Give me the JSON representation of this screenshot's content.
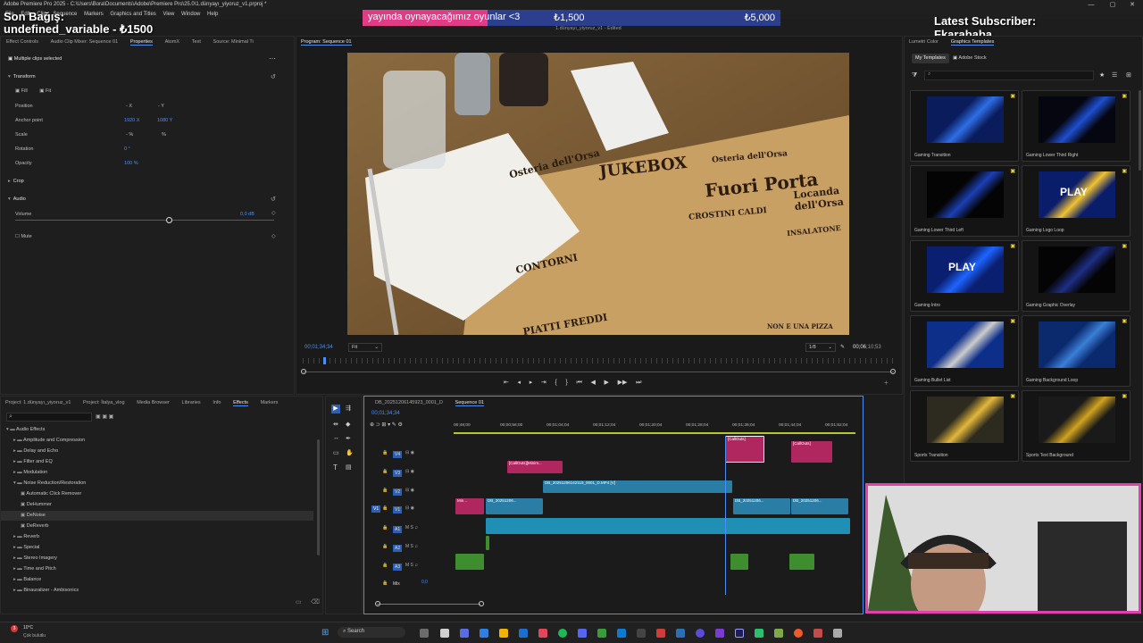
{
  "window": {
    "title": "Adobe Premiere Pro 2025 - C:\\Users\\Bora\\Documents\\Adobe\\Premiere Pro\\25.0\\1.dünyayı_yiyoruz_v1.prproj *",
    "controls": [
      "—",
      "▢",
      "✕"
    ]
  },
  "menu": [
    "File",
    "Edit",
    "Clip",
    "Sequence",
    "Markers",
    "Graphics and Titles",
    "View",
    "Window",
    "Help"
  ],
  "stream": {
    "banner_text": "yayında oynayacağımız oyunlar <3",
    "banner_value_1": "₺1,500",
    "banner_value_2": "₺5,000",
    "overlay_left_1": "Son Bağış:",
    "overlay_left_2": "undefined_variable - ₺1500",
    "overlay_right_1": "Latest Subscriber:",
    "overlay_right_2": "Fkarababa"
  },
  "effect_controls": {
    "tabs": [
      "Effect Controls",
      "Audio Clip Mixer: Sequence 01",
      "Properties",
      "AtomX",
      "Text",
      "Source: Minimal Ti"
    ],
    "active_tab": "Properties",
    "header": "Multiple clips selected",
    "transform_label": "Transform",
    "fill_label": "Fill",
    "fit_label": "Fit",
    "rows": [
      {
        "label": "Position",
        "value1": "- X",
        "value2": "- Y"
      },
      {
        "label": "Anchor point",
        "value1": "1920 X",
        "value2": "1080 Y"
      },
      {
        "label": "Scale",
        "value1": "- %",
        "value2": "%"
      },
      {
        "label": "Rotation",
        "value1": "0 °",
        "value2": ""
      },
      {
        "label": "Opacity",
        "value1": "100 %",
        "value2": ""
      }
    ],
    "crop_label": "Crop",
    "audio_label": "Audio",
    "volume_label": "Volume",
    "volume_value": "0,0 dB",
    "mute_label": "Mute"
  },
  "program": {
    "tab": "Program: Sequence 01",
    "subtitle": "1.dünyayı_yiyoruz_v1 - Edited",
    "timecode": "00;01;34;34",
    "fit": "Fit",
    "quality": "1/8",
    "duration_a": "00;06",
    "duration_b": ";10;53",
    "sign_1": "Osteria dell'Orsa",
    "sign_2": "JUKEBOX",
    "sign_3": "Osteria dell'Orsa",
    "sign_4": "Fuori Porta",
    "sign_5": "Locanda dell'Orsa",
    "sign_6": "CONTORNI",
    "sign_7": "PIATTI FREDDI",
    "sign_8": "CROSTINI CALDI",
    "sign_9": "INSALATONE",
    "sign_10": "NON E UNA PIZZA",
    "controls": [
      "⇤",
      "◂",
      "▸",
      "⇥",
      "{",
      "}",
      "⏮",
      "◀",
      "▶",
      "▶▶",
      "⏭"
    ]
  },
  "project": {
    "tabs": [
      "Project: 1.dünyayı_yiyoruz_v1",
      "Project: İtalya_vlog",
      "Media Browser",
      "Libraries",
      "Info",
      "Effects",
      "Markers"
    ],
    "active_tab": "Effects",
    "search_placeholder": "",
    "items": [
      {
        "label": "Audio Effects",
        "indent": 1,
        "open": true
      },
      {
        "label": "Amplitude and Compression",
        "indent": 2,
        "open": false
      },
      {
        "label": "Delay and Echo",
        "indent": 2,
        "open": false
      },
      {
        "label": "Filter and EQ",
        "indent": 2,
        "open": false
      },
      {
        "label": "Modulation",
        "indent": 2,
        "open": false
      },
      {
        "label": "Noise Reduction/Restoration",
        "indent": 2,
        "open": true
      },
      {
        "label": "Automatic Click Remover",
        "indent": 3,
        "open": false
      },
      {
        "label": "DeHummer",
        "indent": 3,
        "open": false
      },
      {
        "label": "DeNoise",
        "indent": 3,
        "open": false,
        "selected": true
      },
      {
        "label": "DeReverb",
        "indent": 3,
        "open": false
      },
      {
        "label": "Reverb",
        "indent": 2,
        "open": false
      },
      {
        "label": "Special",
        "indent": 2,
        "open": false
      },
      {
        "label": "Stereo Imagery",
        "indent": 2,
        "open": false
      },
      {
        "label": "Time and Pitch",
        "indent": 2,
        "open": false
      },
      {
        "label": "Balance",
        "indent": 2,
        "open": false
      },
      {
        "label": "Binauralizer - Ambisonics",
        "indent": 2,
        "open": false
      }
    ]
  },
  "timeline": {
    "tabs": [
      "DB_20251206145923_0001_D",
      "Sequence 01"
    ],
    "active_tab": "Sequence 01",
    "timecode": "00;01;34;34",
    "ruler": [
      "00;48;00",
      "00;00;56;00",
      "00;01;04;04",
      "00;01;12;04",
      "00;01;20;04",
      "00;01;28;04",
      "00;01;36;04",
      "00;01;44;04",
      "00;01;52;04"
    ],
    "tracks": [
      {
        "id": "V4",
        "type": "video"
      },
      {
        "id": "V3",
        "type": "video"
      },
      {
        "id": "V2",
        "type": "video"
      },
      {
        "id": "V1",
        "type": "video"
      },
      {
        "id": "A1",
        "type": "audio"
      },
      {
        "id": "A2",
        "type": "audio"
      },
      {
        "id": "A3",
        "type": "audio"
      },
      {
        "id": "Mix",
        "type": "mix"
      }
    ],
    "mix_value": "0,0",
    "clip_labels": {
      "callout_1": "[CallOuts]",
      "callout_2": "[CallOuts]",
      "callout_3": "[CallOuts][Minim...",
      "clip_v2": "DB_20251206142119_0001_D.MP4 [V]",
      "clip_v1a": "Min...",
      "clip_v1b": "DB_20251206...",
      "clip_v1c": "DB_20251206...",
      "clip_v1d": "DB_20251206..."
    }
  },
  "templates": {
    "panel_title_1": "Lumetri Color",
    "panel_title_2": "Graphics Templates",
    "tab_my": "My Templates",
    "tab_stock": "Adobe Stock",
    "items": [
      "Gaming Transition",
      "Gaming Lower Third Right",
      "Gaming Lower Third Left",
      "Gaming Logo Loop",
      "Gaming Intro",
      "Gaming Graphic Overlay",
      "Gaming Bullet List",
      "Gaming Background Loop",
      "Sports Transition",
      "Sports Text Background"
    ],
    "badge_text": "PLAY"
  },
  "taskbar": {
    "weather_temp": "10°C",
    "weather_desc": "Çok bulutlu",
    "search_label": "Search",
    "badge": "3"
  },
  "colors": {
    "accent_blue": "#4b8ef7",
    "clip_magenta": "#b0265e",
    "clip_teal": "#2a7ea6",
    "clip_audio": "#1f8fb3",
    "clip_green": "#3e8d2e",
    "banner_pink": "#e23c86",
    "banner_blue": "#2c3f8e",
    "cam_border": "#e33fb3"
  }
}
